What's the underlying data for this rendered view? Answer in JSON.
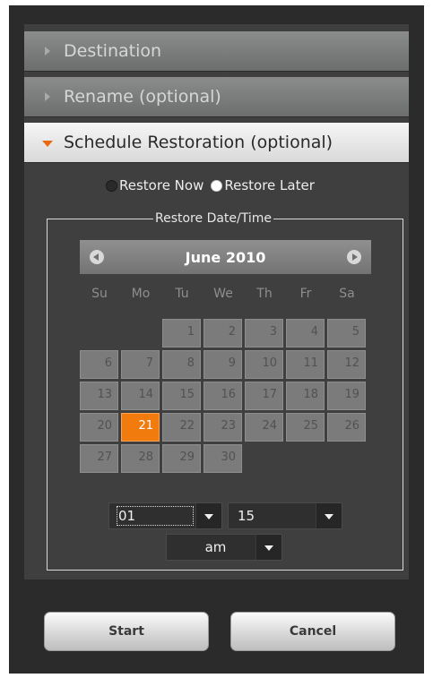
{
  "sections": {
    "destination": "Destination",
    "rename": "Rename (optional)",
    "schedule": "Schedule Restoration (optional)"
  },
  "restore_options": {
    "now_label": "Restore Now",
    "later_label": "Restore Later",
    "selected": "later"
  },
  "datetime_legend": "Restore Date/Time",
  "calendar": {
    "month_label": "June 2010",
    "weekdays": [
      "Su",
      "Mo",
      "Tu",
      "We",
      "Th",
      "Fr",
      "Sa"
    ],
    "days": [
      "1",
      "2",
      "3",
      "4",
      "5",
      "6",
      "7",
      "8",
      "9",
      "10",
      "11",
      "12",
      "13",
      "14",
      "15",
      "16",
      "17",
      "18",
      "19",
      "20",
      "21",
      "22",
      "23",
      "24",
      "25",
      "26",
      "27",
      "28",
      "29",
      "30"
    ],
    "selected_day": "21"
  },
  "time": {
    "hour": "01",
    "minute": "15",
    "ampm": "am"
  },
  "buttons": {
    "start": "Start",
    "cancel": "Cancel"
  },
  "colors": {
    "accent": "#f27b0e",
    "panel": "#3f3f3f",
    "frame": "#2b2b2b"
  }
}
